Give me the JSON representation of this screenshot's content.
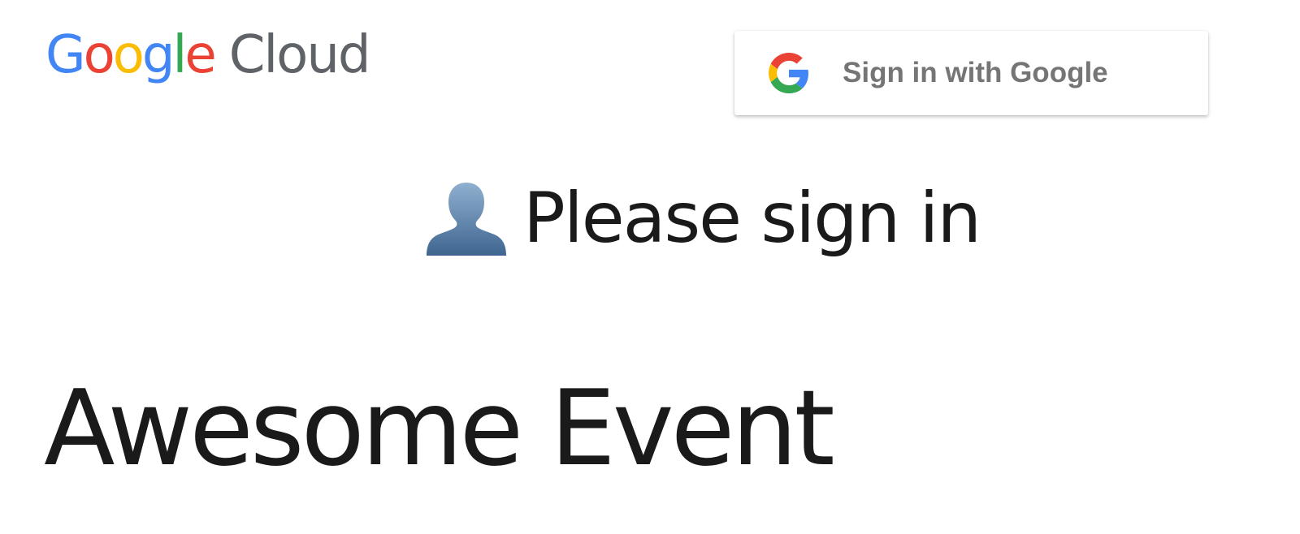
{
  "header": {
    "logo": {
      "letters": [
        {
          "char": "G",
          "color": "#4285F4"
        },
        {
          "char": "o",
          "color": "#EA4335"
        },
        {
          "char": "o",
          "color": "#FBBC05"
        },
        {
          "char": "g",
          "color": "#4285F4"
        },
        {
          "char": "l",
          "color": "#34A853"
        },
        {
          "char": "e",
          "color": "#EA4335"
        }
      ],
      "product": "Cloud",
      "product_color": "#5f6368"
    },
    "signin_button": {
      "label": "Sign in with Google",
      "icon": "google-g-icon"
    }
  },
  "main": {
    "prompt": {
      "icon": "user-silhouette-icon",
      "text": "Please sign in"
    },
    "event_title": "Awesome Event"
  },
  "colors": {
    "google_blue": "#4285F4",
    "google_red": "#EA4335",
    "google_yellow": "#FBBC05",
    "google_green": "#34A853",
    "button_text": "#757575",
    "body_text": "#1a1a1a"
  }
}
